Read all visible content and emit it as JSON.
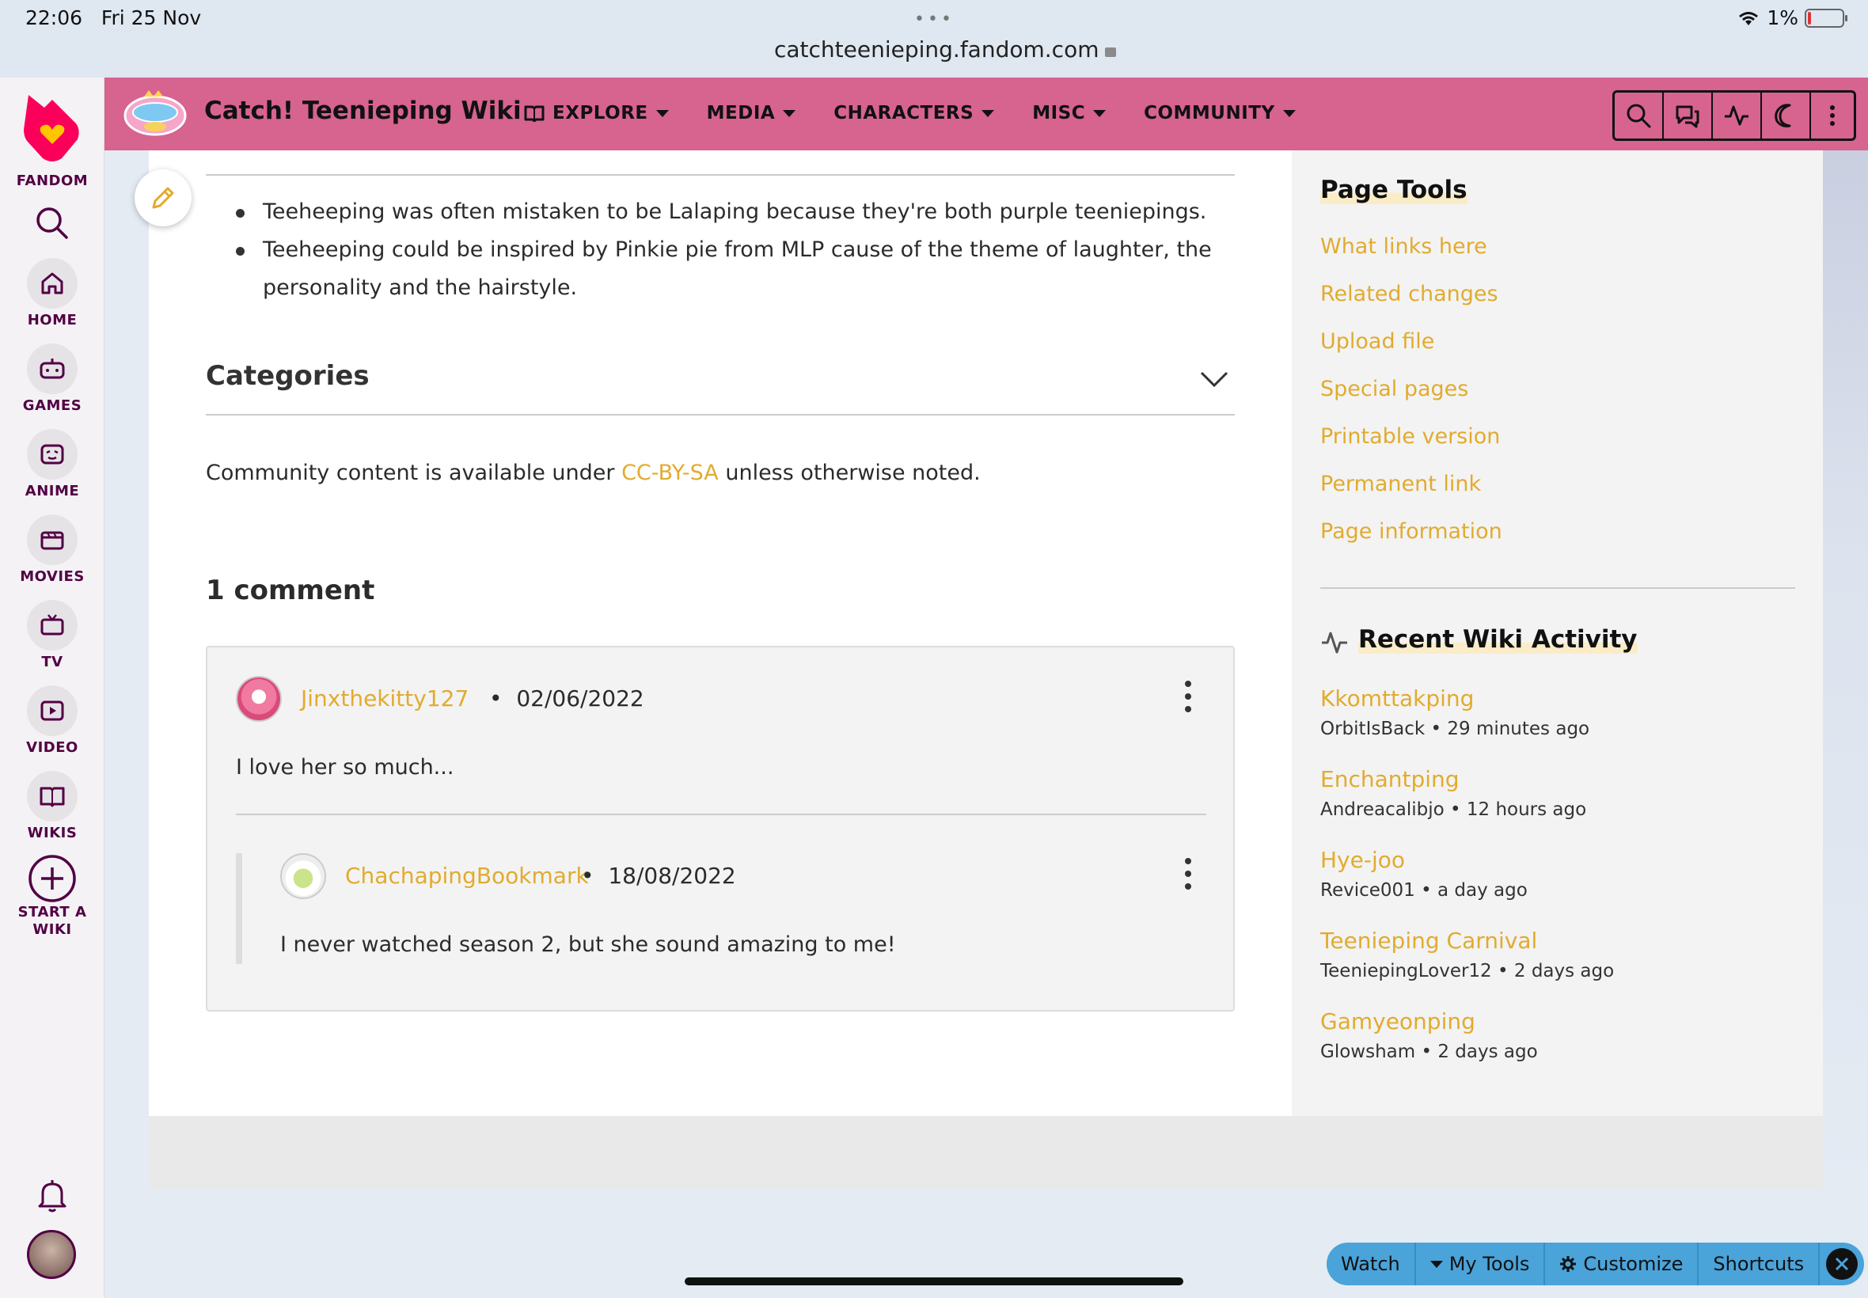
{
  "status_bar": {
    "time": "22:06",
    "date": "Fri 25 Nov",
    "url": "catchteenieping.fandom.com",
    "battery": "1%"
  },
  "rail": {
    "brand": "FANDOM",
    "items": [
      {
        "label": "HOME",
        "icon": "home-icon"
      },
      {
        "label": "GAMES",
        "icon": "gamepad-icon"
      },
      {
        "label": "ANIME",
        "icon": "anime-icon"
      },
      {
        "label": "MOVIES",
        "icon": "clapperboard-icon"
      },
      {
        "label": "TV",
        "icon": "tv-icon"
      },
      {
        "label": "VIDEO",
        "icon": "video-icon"
      },
      {
        "label": "WIKIS",
        "icon": "book-icon"
      }
    ],
    "start_wiki_line1": "START A",
    "start_wiki_line2": "WIKI"
  },
  "header": {
    "wiki_title": "Catch! Teenieping Wiki",
    "nav": [
      "EXPLORE",
      "MEDIA",
      "CHARACTERS",
      "MISC",
      "COMMUNITY"
    ],
    "accent": "#d7638f"
  },
  "article": {
    "trivia": [
      "Teeheeping was often mistaken to be Lalaping because they're both purple teeniepings.",
      "Teeheeping could be inspired by Pinkie pie from MLP cause of the theme of laughter, the personality and the hairstyle."
    ],
    "categories_label": "Categories",
    "license_pre": "Community content is available under ",
    "license_link": "CC-BY-SA",
    "license_post": " unless otherwise noted."
  },
  "comments": {
    "count_label": "1 comment",
    "items": [
      {
        "user": "Jinxthekitty127",
        "date": "02/06/2022",
        "text": "I love her so much..."
      },
      {
        "user": "ChachapingBookmark",
        "date": "18/08/2022",
        "text": "I never watched season 2, but she sound amazing to me!"
      }
    ]
  },
  "page_tools": {
    "title": "Page Tools",
    "links": [
      "What links here",
      "Related changes",
      "Upload file",
      "Special pages",
      "Printable version",
      "Permanent link",
      "Page information"
    ]
  },
  "recent_activity": {
    "title": "Recent Wiki Activity",
    "items": [
      {
        "page": "Kkomttakping",
        "meta": "OrbitIsBack • 29 minutes ago"
      },
      {
        "page": "Enchantping",
        "meta": "Andreacalibjo • 12 hours ago"
      },
      {
        "page": "Hye-joo",
        "meta": "Revice001 • a day ago"
      },
      {
        "page": "Teenieping Carnival",
        "meta": "TeeniepingLover12 • 2 days ago"
      },
      {
        "page": "Gamyeonping",
        "meta": "Glowsham • 2 days ago"
      }
    ]
  },
  "global_tools": {
    "watch": "Watch",
    "my_tools": "My Tools",
    "customize": "Customize",
    "shortcuts": "Shortcuts"
  }
}
